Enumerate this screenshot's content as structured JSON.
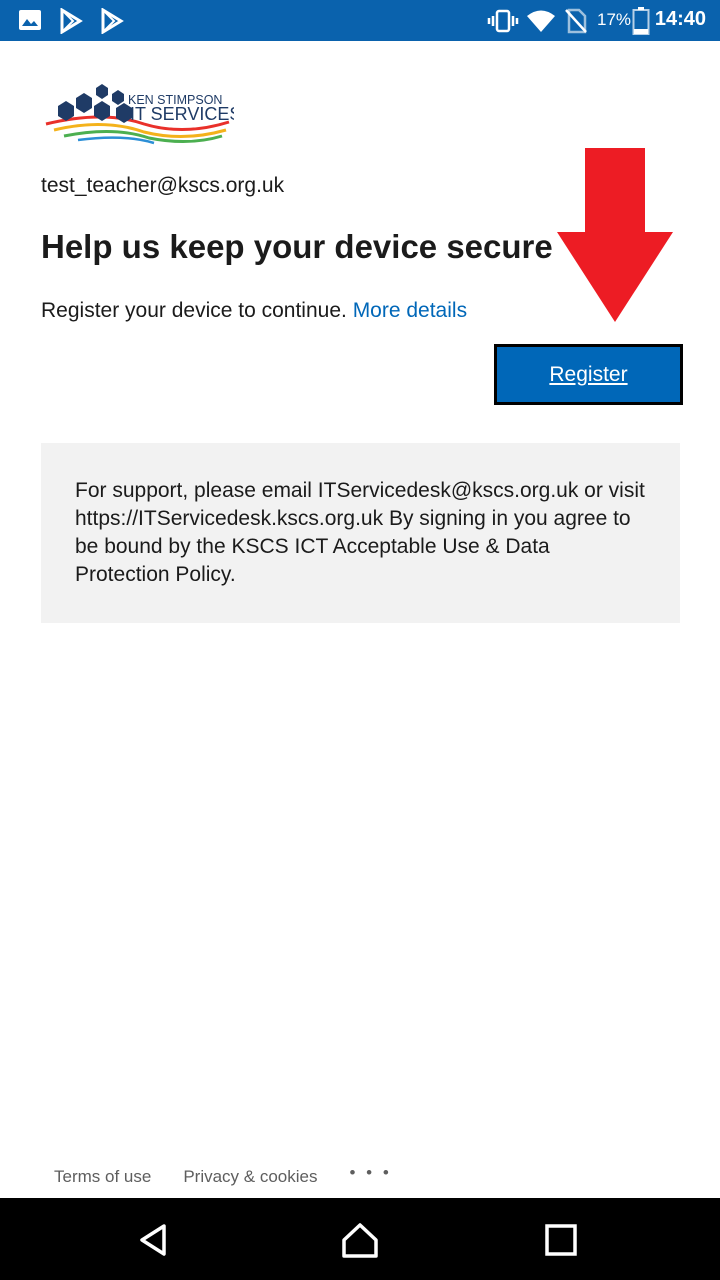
{
  "status_bar": {
    "battery_percent": "17%",
    "time": "14:40",
    "icons": [
      "gallery-icon",
      "play-store-icon",
      "play-store-icon",
      "vibrate-icon",
      "wifi-icon",
      "no-sim-icon",
      "battery-icon"
    ]
  },
  "logo": {
    "line1": "KEN STIMPSON",
    "line2": "IT SERVICES"
  },
  "account_email": "test_teacher@kscs.org.uk",
  "page_title": "Help us keep your device secure",
  "description": {
    "text": "Register your device to continue.",
    "link": "More details"
  },
  "register_button": "Register",
  "support_text": "For support, please email ITServicedesk@kscs.org.uk or visit https://ITServicedesk.kscs.org.uk By signing in you agree to be bound by the KSCS ICT Acceptable Use & Data Protection Policy.",
  "footer": {
    "terms": "Terms of use",
    "privacy": "Privacy & cookies",
    "more": "• • •"
  },
  "colors": {
    "status_bar": "#0a62ad",
    "accent": "#0067b8",
    "arrow": "#ed1c24",
    "support_bg": "#f2f2f2"
  }
}
